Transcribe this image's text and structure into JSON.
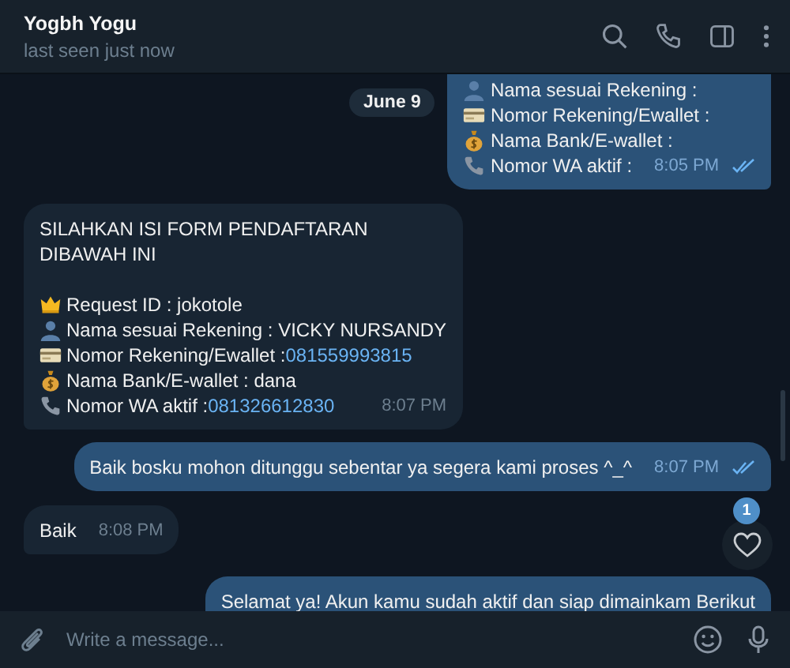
{
  "header": {
    "title": "Yogbh Yogu",
    "status": "last seen just now"
  },
  "messages": [
    {
      "kind": "date",
      "text": "June 9"
    },
    {
      "kind": "out",
      "cut_top": true,
      "lines": [
        {
          "kind": "person",
          "text": "Nama sesuai Rekening :"
        },
        {
          "kind": "card",
          "text": "Nomor Rekening/Ewallet :"
        },
        {
          "kind": "moneybag",
          "text": "Nama Bank/E-wallet :"
        },
        {
          "kind": "phone",
          "text": "Nomor WA aktif :"
        }
      ],
      "time": "8:05 PM",
      "read": true
    },
    {
      "kind": "in",
      "lines": [
        {
          "kind": "text",
          "text": "SILAHKAN ISI FORM PENDAFTARAN"
        },
        {
          "kind": "text",
          "text": "DIBAWAH INI"
        },
        {
          "kind": "blank"
        },
        {
          "kind": "crown",
          "text": "Request ID : jokotole"
        },
        {
          "kind": "person",
          "text": "Nama sesuai Rekening : VICKY NURSANDY"
        },
        {
          "kind": "card",
          "text": "Nomor Rekening/Ewallet :",
          "link": "081559993815"
        },
        {
          "kind": "moneybag",
          "text": "Nama Bank/E-wallet : dana"
        },
        {
          "kind": "phone",
          "text": "Nomor WA aktif :",
          "link": "081326612830"
        }
      ],
      "time": "8:07 PM"
    },
    {
      "kind": "out",
      "lines": [
        {
          "kind": "text",
          "text": "Baik bosku mohon ditunggu sebentar ya segera kami proses ^_^"
        }
      ],
      "time": "8:07 PM",
      "read": true
    },
    {
      "kind": "in",
      "lines": [
        {
          "kind": "text",
          "text": "Baik"
        }
      ],
      "time": "8:08 PM"
    },
    {
      "kind": "out",
      "cut_bottom": true,
      "lines": [
        {
          "kind": "text",
          "text": "Selamat ya! Akun kamu sudah aktif dan siap dimainkam Berikut"
        }
      ]
    }
  ],
  "reactions": {
    "count": "1"
  },
  "composer": {
    "placeholder": "Write a message..."
  }
}
